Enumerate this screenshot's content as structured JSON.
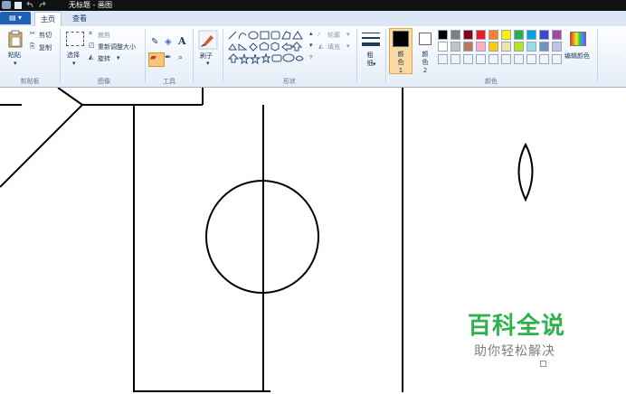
{
  "window": {
    "title": "无标题 - 画图"
  },
  "tabs": {
    "file": "▤ ▾",
    "home": "主页",
    "view": "查看"
  },
  "ribbon": {
    "clipboard": {
      "paste": "粘贴",
      "cut": "剪切",
      "copy": "复制",
      "group": "剪贴板"
    },
    "image": {
      "select": "选择",
      "crop": "裁剪",
      "resize": "重新调整大小",
      "rotate": "旋转",
      "group": "图像"
    },
    "tools": {
      "group": "工具",
      "text_tool": "A"
    },
    "brushes": {
      "label": "刷子"
    },
    "shapes": {
      "outline": "轮廓",
      "fill": "填充",
      "group": "形状"
    },
    "size": {
      "label": "粗细"
    },
    "colors": {
      "color1": "颜色 1",
      "color2": "颜色 2",
      "edit": "编辑颜色",
      "group": "颜色",
      "color1_value": "#000000",
      "color2_value": "#ffffff",
      "palette_row1": [
        "#000000",
        "#7f7f7f",
        "#880015",
        "#ed1c24",
        "#ff7f27",
        "#fff200",
        "#22b14c",
        "#00a2e8",
        "#3f48cc",
        "#a349a4"
      ],
      "palette_row2": [
        "#ffffff",
        "#c3c3c3",
        "#b97a57",
        "#ffaec9",
        "#ffc90e",
        "#efe4b0",
        "#b5e61d",
        "#99d9ea",
        "#7092be",
        "#c8bfe7"
      ]
    }
  },
  "watermark": {
    "main": "百科全说",
    "sub": "助你轻松解决"
  }
}
